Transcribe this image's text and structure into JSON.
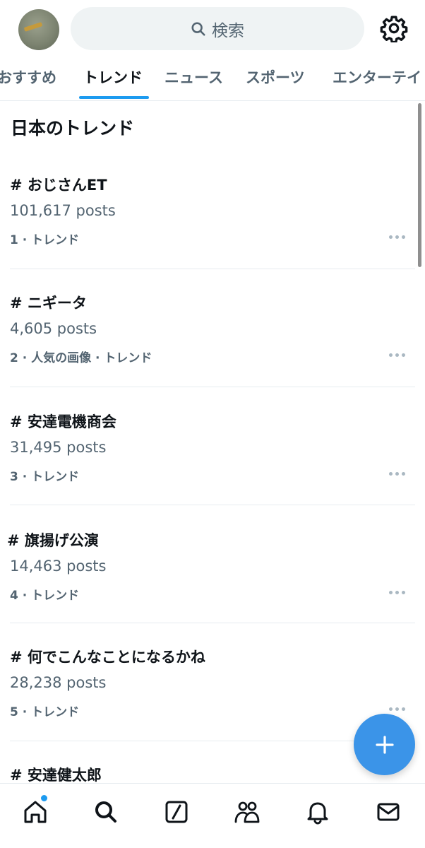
{
  "search": {
    "placeholder": "検索"
  },
  "tabs": [
    {
      "label": "おすすめ"
    },
    {
      "label": "トレンド"
    },
    {
      "label": "ニュース"
    },
    {
      "label": "スポーツ"
    },
    {
      "label": "エンターテイ"
    }
  ],
  "section_title": "日本のトレンド",
  "trends": [
    {
      "name": "# おじさんET",
      "posts": "101,617 posts",
      "meta": "1 · トレンド"
    },
    {
      "name": "# ニギータ",
      "posts": "4,605 posts",
      "meta": "2 · 人気の画像 · トレンド"
    },
    {
      "name": "# 安達電機商会",
      "posts": "31,495 posts",
      "meta": "3 · トレンド"
    },
    {
      "name": "# 旗揚げ公演",
      "posts": "14,463 posts",
      "meta": "4 · トレンド"
    },
    {
      "name": "# 何でこんなことになるかね",
      "posts": "28,238 posts",
      "meta": "5 · トレンド"
    },
    {
      "name": "# 安達健太郎"
    }
  ],
  "icons": {
    "search": "search-icon",
    "settings": "gear-icon",
    "more": "more-dots-icon",
    "compose": "plus-icon",
    "nav": [
      "home-icon",
      "search-icon",
      "grok-icon",
      "communities-icon",
      "bell-icon",
      "mail-icon"
    ]
  },
  "colors": {
    "accent": "#1d9bf0",
    "fab": "#3b94e8",
    "secondary_text": "#536471"
  }
}
